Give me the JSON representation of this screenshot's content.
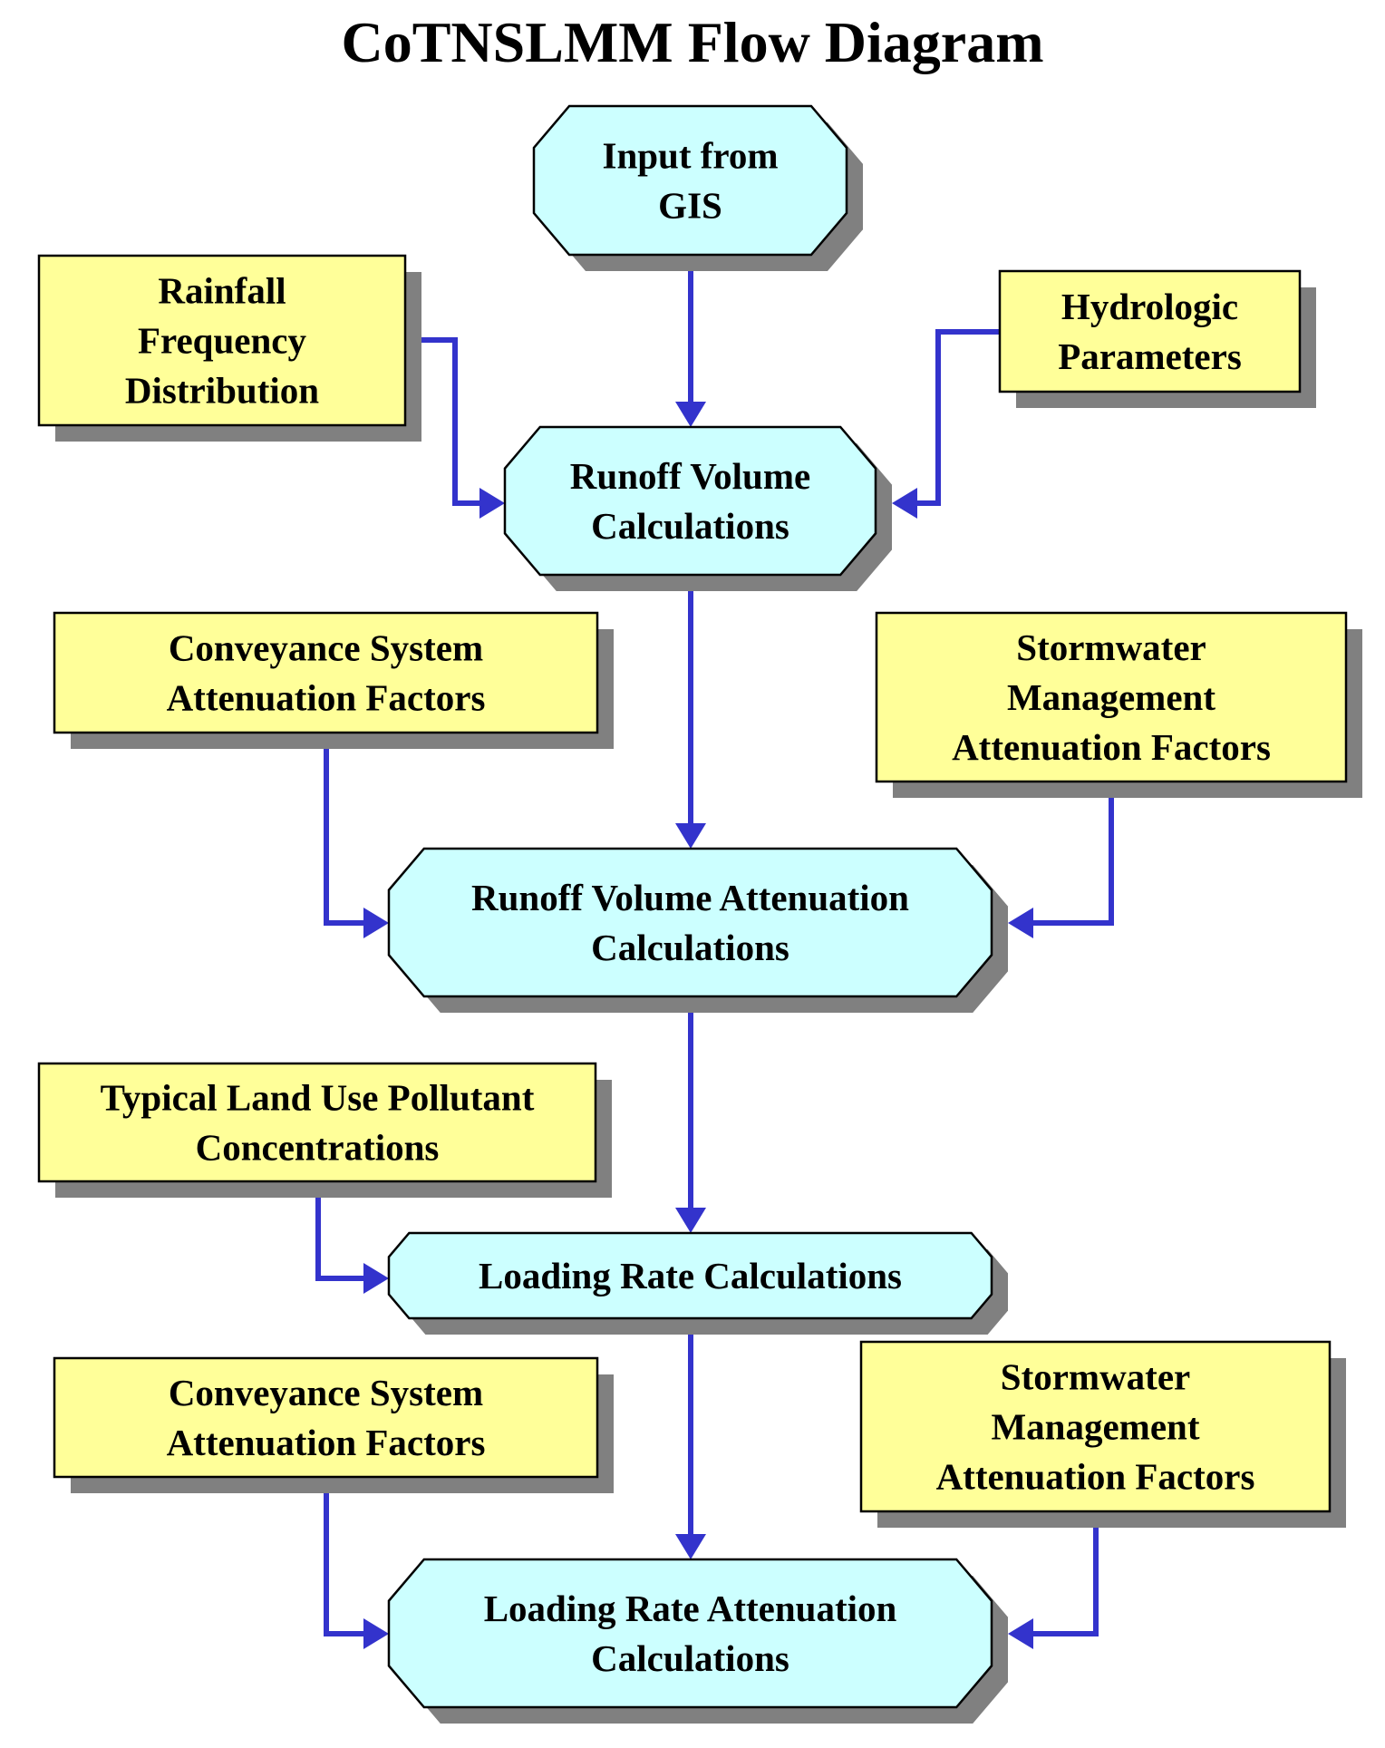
{
  "title": "CoTNSLMM  Flow Diagram",
  "colors": {
    "input_node_fill": "#FFFF99",
    "process_node_fill": "#CCFFFF",
    "connector": "#3333CC",
    "shadow": "#808080",
    "outline": "#000000"
  },
  "nodes": [
    {
      "id": "input-from-gis",
      "kind": "process",
      "lines": [
        "Input from",
        "GIS"
      ]
    },
    {
      "id": "rainfall-frequency-distribution",
      "kind": "input",
      "lines": [
        "Rainfall",
        "Frequency",
        "Distribution"
      ]
    },
    {
      "id": "hydrologic-parameters",
      "kind": "input",
      "lines": [
        "Hydrologic",
        "Parameters"
      ]
    },
    {
      "id": "runoff-volume-calculations",
      "kind": "process",
      "lines": [
        "Runoff Volume",
        "Calculations"
      ]
    },
    {
      "id": "conveyance-system-attenuation-factors-1",
      "kind": "input",
      "lines": [
        "Conveyance System",
        "Attenuation Factors"
      ]
    },
    {
      "id": "stormwater-management-attenuation-factors-1",
      "kind": "input",
      "lines": [
        "Stormwater",
        "Management",
        "Attenuation Factors"
      ]
    },
    {
      "id": "runoff-volume-attenuation-calculations",
      "kind": "process",
      "lines": [
        "Runoff Volume Attenuation",
        "Calculations"
      ]
    },
    {
      "id": "typical-land-use-pollutant-concentrations",
      "kind": "input",
      "lines": [
        "Typical Land Use Pollutant",
        "Concentrations"
      ]
    },
    {
      "id": "loading-rate-calculations",
      "kind": "process",
      "lines": [
        "Loading Rate Calculations"
      ]
    },
    {
      "id": "conveyance-system-attenuation-factors-2",
      "kind": "input",
      "lines": [
        "Conveyance System",
        "Attenuation Factors"
      ]
    },
    {
      "id": "stormwater-management-attenuation-factors-2",
      "kind": "input",
      "lines": [
        "Stormwater",
        "Management",
        "Attenuation Factors"
      ]
    },
    {
      "id": "loading-rate-attenuation-calculations",
      "kind": "process",
      "lines": [
        "Loading Rate Attenuation",
        "Calculations"
      ]
    }
  ],
  "edges": [
    {
      "from": "input-from-gis",
      "to": "runoff-volume-calculations"
    },
    {
      "from": "rainfall-frequency-distribution",
      "to": "runoff-volume-calculations"
    },
    {
      "from": "hydrologic-parameters",
      "to": "runoff-volume-calculations"
    },
    {
      "from": "runoff-volume-calculations",
      "to": "runoff-volume-attenuation-calculations"
    },
    {
      "from": "conveyance-system-attenuation-factors-1",
      "to": "runoff-volume-attenuation-calculations"
    },
    {
      "from": "stormwater-management-attenuation-factors-1",
      "to": "runoff-volume-attenuation-calculations"
    },
    {
      "from": "runoff-volume-attenuation-calculations",
      "to": "loading-rate-calculations"
    },
    {
      "from": "typical-land-use-pollutant-concentrations",
      "to": "loading-rate-calculations"
    },
    {
      "from": "loading-rate-calculations",
      "to": "loading-rate-attenuation-calculations"
    },
    {
      "from": "conveyance-system-attenuation-factors-2",
      "to": "loading-rate-attenuation-calculations"
    },
    {
      "from": "stormwater-management-attenuation-factors-2",
      "to": "loading-rate-attenuation-calculations"
    }
  ]
}
